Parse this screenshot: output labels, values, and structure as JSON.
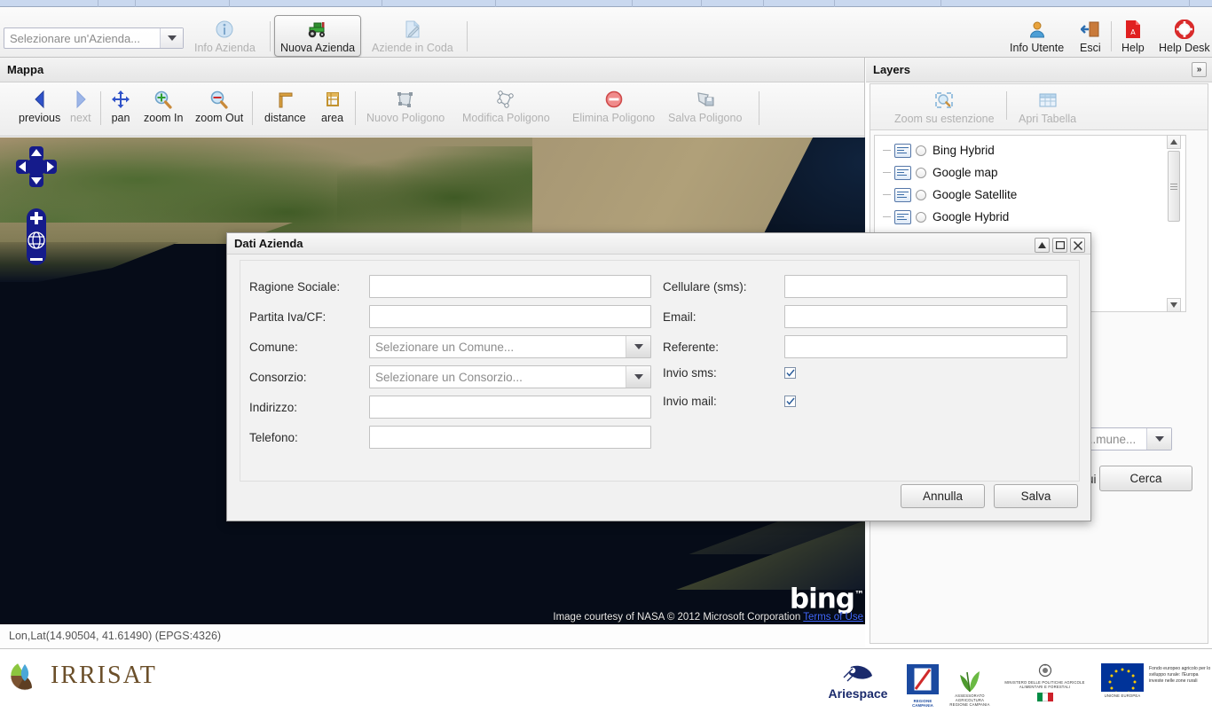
{
  "app": {
    "company_select": {
      "placeholder": "Selezionare un'Azienda...",
      "icon": "chevron-down-icon"
    },
    "toolbar_left": [
      {
        "label": "Info Azienda",
        "icon": "info-icon",
        "state": "disabled"
      },
      {
        "label": "Nuova Azienda",
        "icon": "tractor-icon",
        "state": "active"
      },
      {
        "label": "Aziende in Coda",
        "icon": "document-edit-icon",
        "state": "disabled"
      }
    ],
    "toolbar_right": [
      {
        "label": "Info Utente",
        "icon": "user-icon",
        "state": "enabled"
      },
      {
        "label": "Esci",
        "icon": "logout-icon",
        "state": "enabled"
      },
      {
        "label": "Help",
        "icon": "pdf-icon",
        "state": "enabled"
      },
      {
        "label": "Help Desk",
        "icon": "lifering-icon",
        "state": "enabled"
      }
    ]
  },
  "map": {
    "title": "Mappa",
    "tools": [
      {
        "label": "previous",
        "icon": "arrow-left-icon",
        "state": "enabled"
      },
      {
        "label": "next",
        "icon": "arrow-right-icon",
        "state": "disabled"
      },
      {
        "label": "pan",
        "icon": "pan-move-icon",
        "state": "enabled"
      },
      {
        "label": "zoom In",
        "icon": "magnifier-plus-icon",
        "state": "enabled"
      },
      {
        "label": "zoom Out",
        "icon": "magnifier-minus-icon",
        "state": "enabled"
      },
      {
        "label": "distance",
        "icon": "ruler-icon",
        "state": "enabled"
      },
      {
        "label": "area",
        "icon": "area-measure-icon",
        "state": "enabled"
      },
      {
        "label": "Nuovo Poligono",
        "icon": "polygon-new-icon",
        "state": "disabled"
      },
      {
        "label": "Modifica Poligono",
        "icon": "polygon-edit-icon",
        "state": "disabled"
      },
      {
        "label": "Elimina Poligono",
        "icon": "polygon-delete-icon",
        "state": "disabled"
      },
      {
        "label": "Salva Poligono",
        "icon": "polygon-save-icon",
        "state": "disabled"
      }
    ],
    "nav_control": {
      "up": "pan-up-icon",
      "down": "pan-down-icon",
      "left": "pan-left-icon",
      "right": "pan-right-icon",
      "zoom_in": "zoom-in-plus-icon",
      "globe": "globe-icon",
      "zoom_out": "zoom-out-minus-icon"
    },
    "attribution": {
      "logo": "bing",
      "trademark": "™",
      "text": "Image courtesy of NASA © 2012 Microsoft Corporation",
      "link": "Terms of Use"
    },
    "status": "Lon,Lat(14.90504, 41.61490) (EPGS:4326)"
  },
  "layers": {
    "title": "Layers",
    "collapse_icon": "double-chevron-right-icon",
    "tools": [
      {
        "label": "Zoom su estenzione",
        "icon": "zoom-extent-icon",
        "state": "disabled"
      },
      {
        "label": "Apri Tabella",
        "icon": "table-icon",
        "state": "disabled"
      }
    ],
    "items": [
      {
        "label": "Bing Hybrid",
        "icon": "layer-icon",
        "selected": false
      },
      {
        "label": "Google map",
        "icon": "layer-icon",
        "selected": false
      },
      {
        "label": "Google Satellite",
        "icon": "layer-icon",
        "selected": false
      },
      {
        "label": "Google Hybrid",
        "icon": "layer-icon",
        "selected": false
      }
    ],
    "scrollbar": {
      "up_icon": "scroll-up-arrow-icon",
      "down_icon": "scroll-down-arrow-icon"
    }
  },
  "search_form": {
    "comune_select": {
      "value": "...mune...",
      "icon": "chevron-down-icon"
    },
    "partial_label": "ui",
    "search_button": "Cerca"
  },
  "dialog": {
    "title": "Dati Azienda",
    "window_tools": [
      {
        "name": "collapse-button",
        "icon": "caret-up-icon"
      },
      {
        "name": "maximize-button",
        "icon": "square-icon"
      },
      {
        "name": "close-button",
        "icon": "close-x-icon"
      }
    ],
    "left_fields": [
      {
        "label": "Ragione Sociale:",
        "type": "text",
        "value": ""
      },
      {
        "label": "Partita Iva/CF:",
        "type": "text",
        "value": ""
      },
      {
        "label": "Comune:",
        "type": "select",
        "value": "Selezionare un Comune...",
        "icon": "chevron-down-icon"
      },
      {
        "label": "Consorzio:",
        "type": "select",
        "value": "Selezionare un Consorzio...",
        "icon": "chevron-down-icon"
      },
      {
        "label": "Indirizzo:",
        "type": "text",
        "value": ""
      },
      {
        "label": "Telefono:",
        "type": "text",
        "value": ""
      }
    ],
    "right_fields": [
      {
        "label": "Cellulare (sms):",
        "type": "text",
        "value": ""
      },
      {
        "label": "Email:",
        "type": "text",
        "value": ""
      },
      {
        "label": "Referente:",
        "type": "text",
        "value": ""
      },
      {
        "label": "Invio sms:",
        "type": "checkbox",
        "checked": true
      },
      {
        "label": "Invio mail:",
        "type": "checkbox",
        "checked": true
      }
    ],
    "cancel_button": "Annulla",
    "save_button": "Salva"
  },
  "footer": {
    "brand": "IRRISAT",
    "logos": [
      {
        "name": "ariespace-logo",
        "text": "Ariespace"
      },
      {
        "name": "regione-campania-logo",
        "text": "REGIONE CAMPANIA"
      },
      {
        "name": "plant-logo",
        "text": "ASSESSORATO AGRICOLTURA REGIONE CAMPANIA"
      },
      {
        "name": "ministero-logo",
        "text": "MINISTERO DELLE POLITICHE AGRICOLE ALIMENTARI E FORESTALI"
      },
      {
        "name": "eu-flag-logo",
        "text": "UNIONE EUROPEA",
        "caption": "Fondo europeo agricolo per lo sviluppo rurale: l'Europa investe nelle zone rurali"
      }
    ]
  },
  "colors": {
    "accent_blue": "#151b8b",
    "sea": "#06101f",
    "land": "#9f9172",
    "vegetation": "#3f5a25",
    "panel_bg": "#f1f1f1",
    "eu_blue": "#003399",
    "eu_yellow": "#ffcc00"
  }
}
